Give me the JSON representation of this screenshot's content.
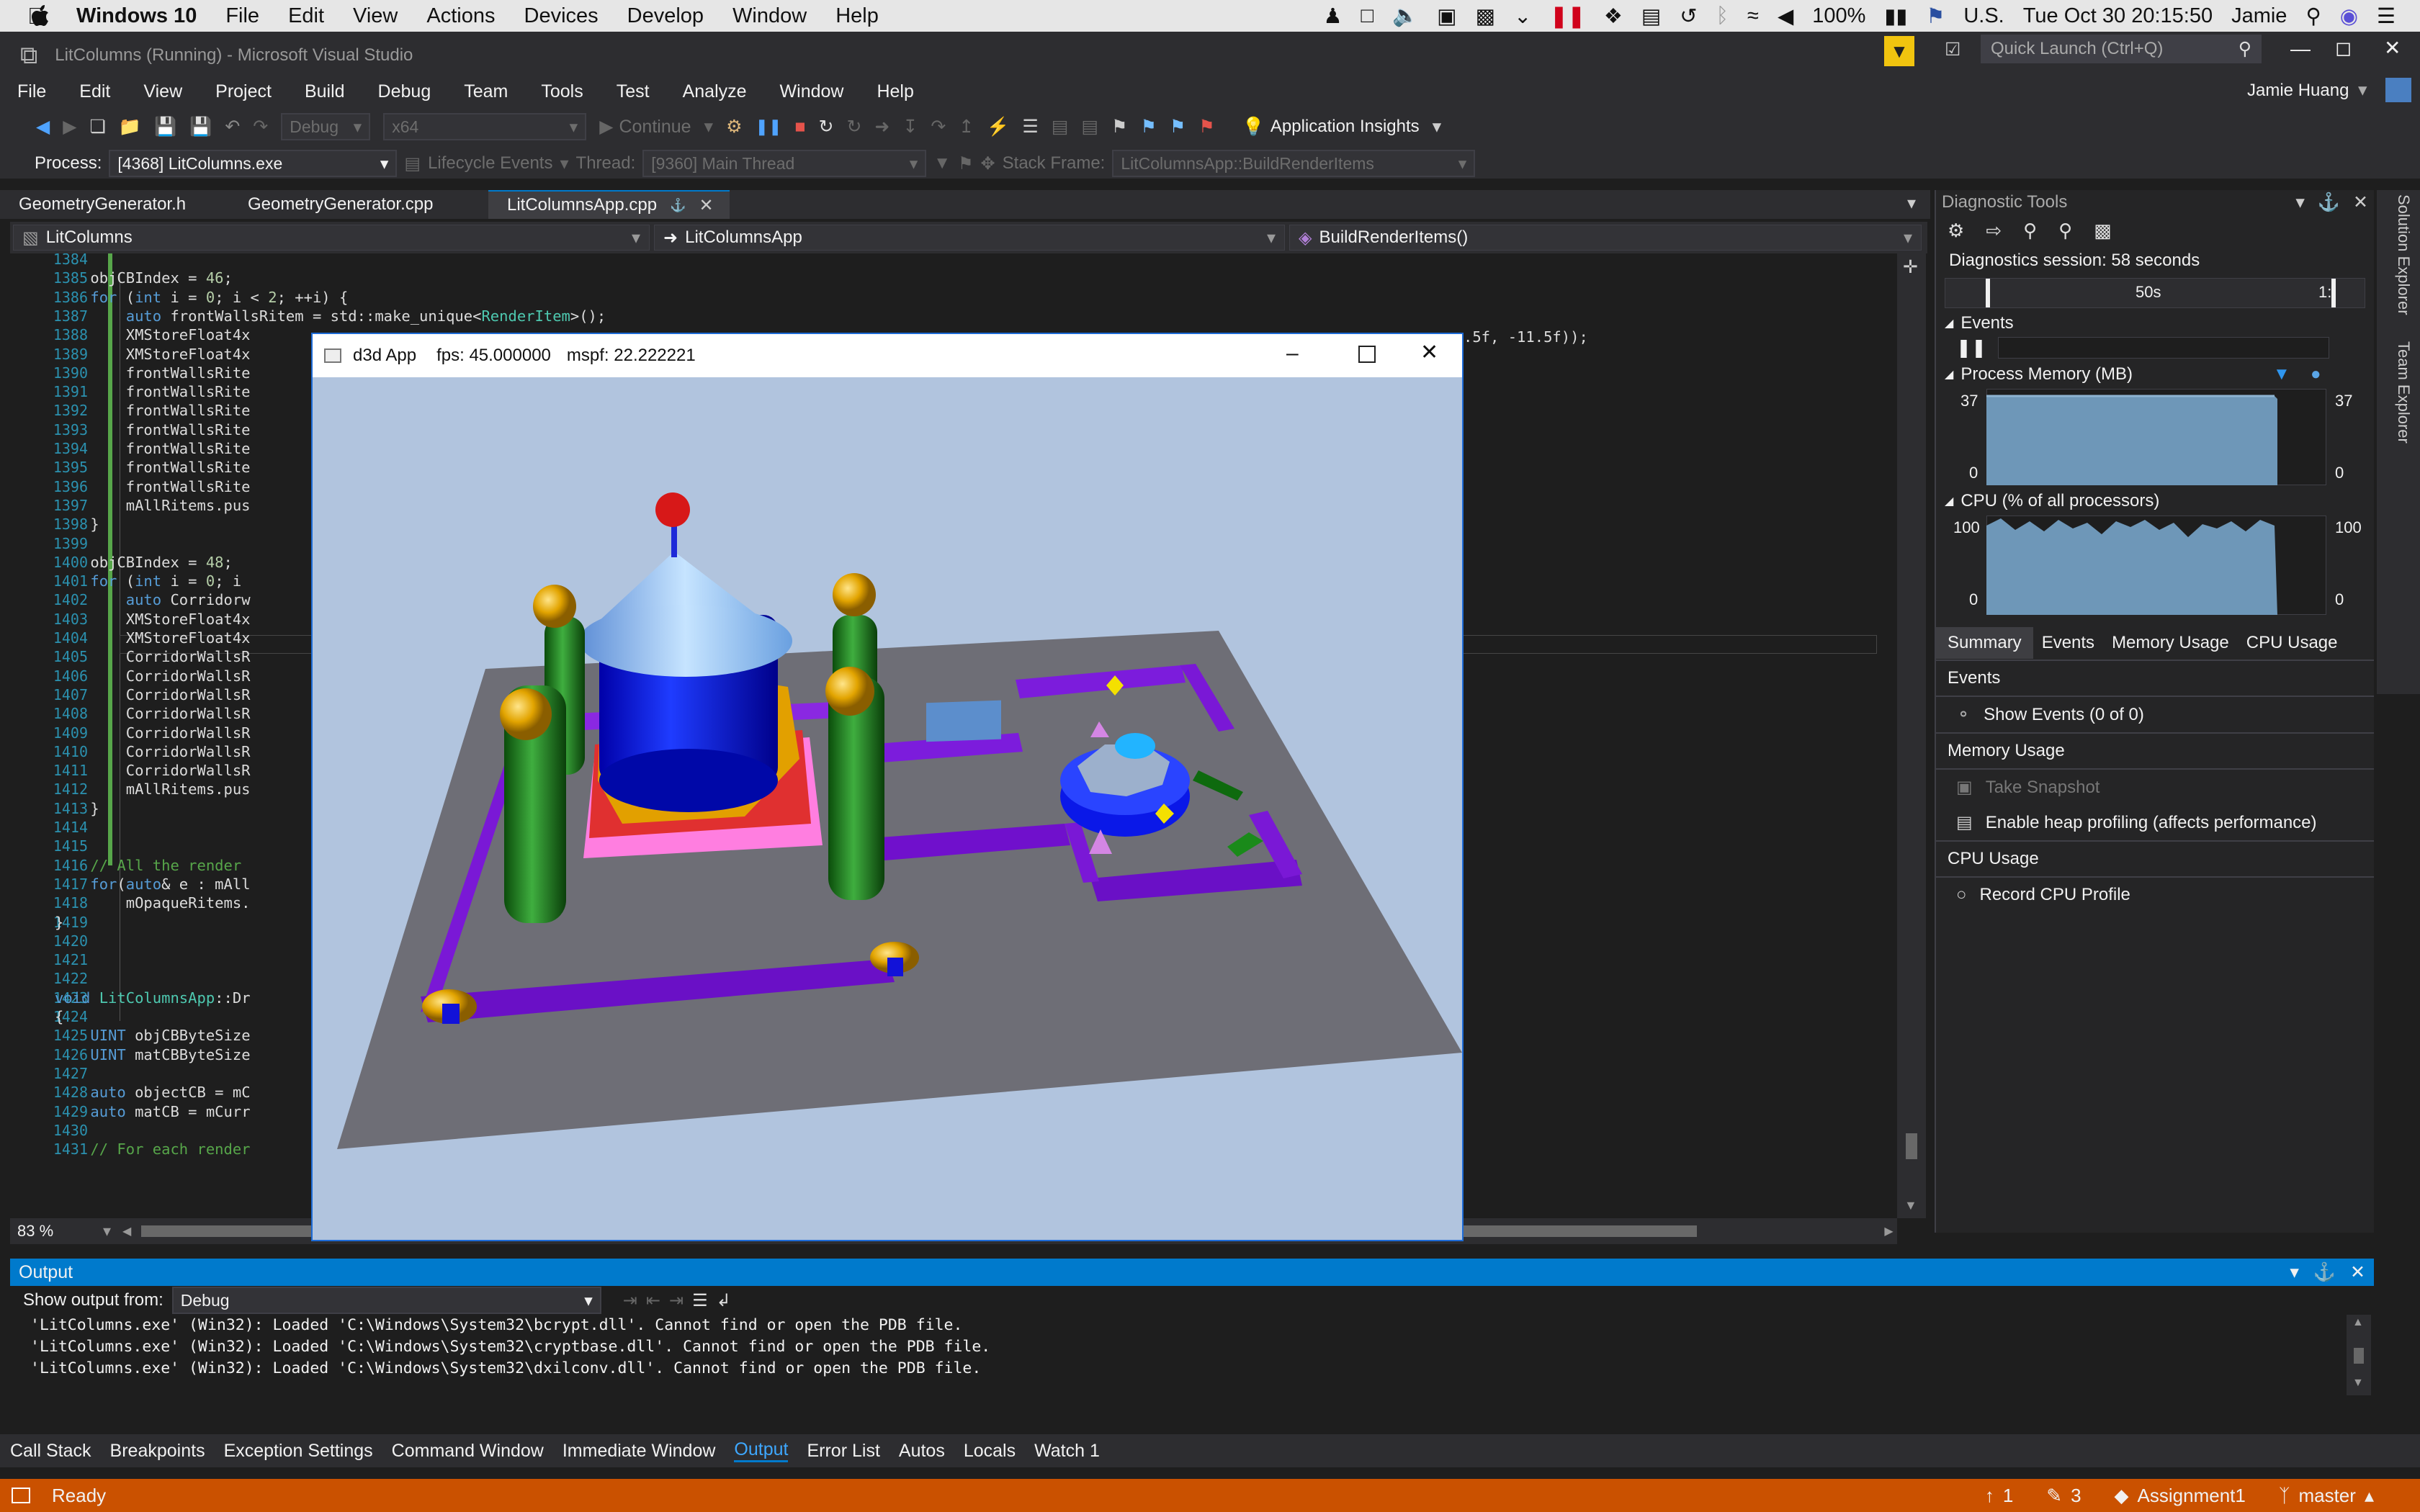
{
  "mac": {
    "os": "Windows 10",
    "menus": [
      "File",
      "Edit",
      "View",
      "Actions",
      "Devices",
      "Develop",
      "Window",
      "Help"
    ],
    "battery": "100%",
    "input": "U.S.",
    "clock": "Tue Oct 30  20:15:50",
    "user": "Jamie"
  },
  "vs": {
    "title": "LitColumns (Running) - Microsoft Visual Studio",
    "quick_launch": "Quick Launch (Ctrl+Q)",
    "user": "Jamie Huang",
    "menus": [
      "File",
      "Edit",
      "View",
      "Project",
      "Build",
      "Debug",
      "Team",
      "Tools",
      "Test",
      "Analyze",
      "Window",
      "Help"
    ],
    "config": "Debug",
    "platform": "x64",
    "continue": "Continue",
    "app_insights": "Application Insights",
    "process_label": "Process:",
    "process": "[4368] LitColumns.exe",
    "lifecycle": "Lifecycle Events",
    "thread_label": "Thread:",
    "thread": "[9360] Main Thread",
    "stack_label": "Stack Frame:",
    "stack": "LitColumnsApp::BuildRenderItems"
  },
  "tabs": [
    "GeometryGenerator.h",
    "GeometryGenerator.cpp",
    "LitColumnsApp.cpp"
  ],
  "nav": {
    "project": "LitColumns",
    "class": "LitColumnsApp",
    "method": "BuildRenderItems()"
  },
  "code": [
    {
      "n": "1384",
      "t": ""
    },
    {
      "n": "1385",
      "t": "    objCBIndex = 46;"
    },
    {
      "n": "1386",
      "t": "    for (int i = 0; i < 2; ++i) {"
    },
    {
      "n": "1387",
      "t": "        auto frontWallsRitem = std::make_unique<RenderItem>();"
    },
    {
      "n": "1388",
      "t": "        XMStoreFloat4x"
    },
    {
      "n": "1389",
      "t": "        XMStoreFloat4x"
    },
    {
      "n": "1390",
      "t": "        frontWallsRite"
    },
    {
      "n": "1391",
      "t": "        frontWallsRite"
    },
    {
      "n": "1392",
      "t": "        frontWallsRite"
    },
    {
      "n": "1393",
      "t": "        frontWallsRite"
    },
    {
      "n": "1394",
      "t": "        frontWallsRite"
    },
    {
      "n": "1395",
      "t": "        frontWallsRite"
    },
    {
      "n": "1396",
      "t": "        frontWallsRite"
    },
    {
      "n": "1397",
      "t": "        mAllRitems.pus"
    },
    {
      "n": "1398",
      "t": "    }"
    },
    {
      "n": "1399",
      "t": ""
    },
    {
      "n": "1400",
      "t": "    objCBIndex = 48;"
    },
    {
      "n": "1401",
      "t": "    for (int i = 0; i"
    },
    {
      "n": "1402",
      "t": "        auto Corridorw"
    },
    {
      "n": "1403",
      "t": "        XMStoreFloat4x"
    },
    {
      "n": "1404",
      "t": "        XMStoreFloat4x"
    },
    {
      "n": "1405",
      "t": "        CorridorWallsR"
    },
    {
      "n": "1406",
      "t": "        CorridorWallsR"
    },
    {
      "n": "1407",
      "t": "        CorridorWallsR"
    },
    {
      "n": "1408",
      "t": "        CorridorWallsR"
    },
    {
      "n": "1409",
      "t": "        CorridorWallsR"
    },
    {
      "n": "1410",
      "t": "        CorridorWallsR"
    },
    {
      "n": "1411",
      "t": "        CorridorWallsR"
    },
    {
      "n": "1412",
      "t": "        mAllRitems.pus"
    },
    {
      "n": "1413",
      "t": "    }"
    },
    {
      "n": "1414",
      "t": ""
    },
    {
      "n": "1415",
      "t": ""
    },
    {
      "n": "1416",
      "t": "    // All the render"
    },
    {
      "n": "1417",
      "t": "    for(auto& e : mAll"
    },
    {
      "n": "1418",
      "t": "        mOpaqueRitems."
    },
    {
      "n": "1419",
      "t": "}"
    },
    {
      "n": "1420",
      "t": ""
    },
    {
      "n": "1421",
      "t": ""
    },
    {
      "n": "1422",
      "t": ""
    },
    {
      "n": "1423",
      "t": "void LitColumnsApp::Dr"
    },
    {
      "n": "1424",
      "t": "{"
    },
    {
      "n": "1425",
      "t": "    UINT objCBByteSize"
    },
    {
      "n": "1426",
      "t": "    UINT matCBByteSize"
    },
    {
      "n": "1427",
      "t": ""
    },
    {
      "n": "1428",
      "t": "    auto objectCB = mC"
    },
    {
      "n": "1429",
      "t": "    auto matCB = mCurr"
    },
    {
      "n": "1430",
      "t": ""
    },
    {
      "n": "1431",
      "t": "    // For each render"
    }
  ],
  "code_overflow": ".5f, -11.5f));",
  "zoom": "83 %",
  "d3d": {
    "title": "d3d App",
    "fps": "fps: 45.000000",
    "mspf": "mspf: 22.222221"
  },
  "diag": {
    "title": "Diagnostic Tools",
    "session": "Diagnostics session: 58 seconds",
    "timeline_label": "50s",
    "timeline_end": "1:",
    "events_label": "Events",
    "memory_label": "Process Memory (MB)",
    "mem_max": "37",
    "mem_min": "0",
    "cpu_label": "CPU (% of all processors)",
    "cpu_max": "100",
    "cpu_min": "0",
    "tabs": [
      "Summary",
      "Events",
      "Memory Usage",
      "CPU Usage"
    ],
    "sec_events": "Events",
    "show_events": "Show Events (0 of 0)",
    "sec_memory": "Memory Usage",
    "take_snapshot": "Take Snapshot",
    "heap": "Enable heap profiling (affects performance)",
    "sec_cpu": "CPU Usage",
    "record_cpu": "Record CPU Profile"
  },
  "side_tabs": [
    "Solution Explorer",
    "Team Explorer"
  ],
  "output": {
    "title": "Output",
    "show_from": "Show output from:",
    "source": "Debug",
    "lines": [
      "'LitColumns.exe' (Win32): Loaded 'C:\\Windows\\System32\\bcrypt.dll'. Cannot find or open the PDB file.",
      "'LitColumns.exe' (Win32): Loaded 'C:\\Windows\\System32\\cryptbase.dll'. Cannot find or open the PDB file.",
      "'LitColumns.exe' (Win32): Loaded 'C:\\Windows\\System32\\dxilconv.dll'. Cannot find or open the PDB file."
    ]
  },
  "bottom_tabs": [
    "Call Stack",
    "Breakpoints",
    "Exception Settings",
    "Command Window",
    "Immediate Window",
    "Output",
    "Error List",
    "Autos",
    "Locals",
    "Watch 1"
  ],
  "status": {
    "ready": "Ready",
    "up": "1",
    "edits": "3",
    "repo": "Assignment1",
    "branch": "master"
  },
  "colors": {
    "accent": "#007acc",
    "status": "#ca5100",
    "bg": "#1e1e1e",
    "chrome": "#2d2d30",
    "scene_bg": "#b1c4de"
  }
}
